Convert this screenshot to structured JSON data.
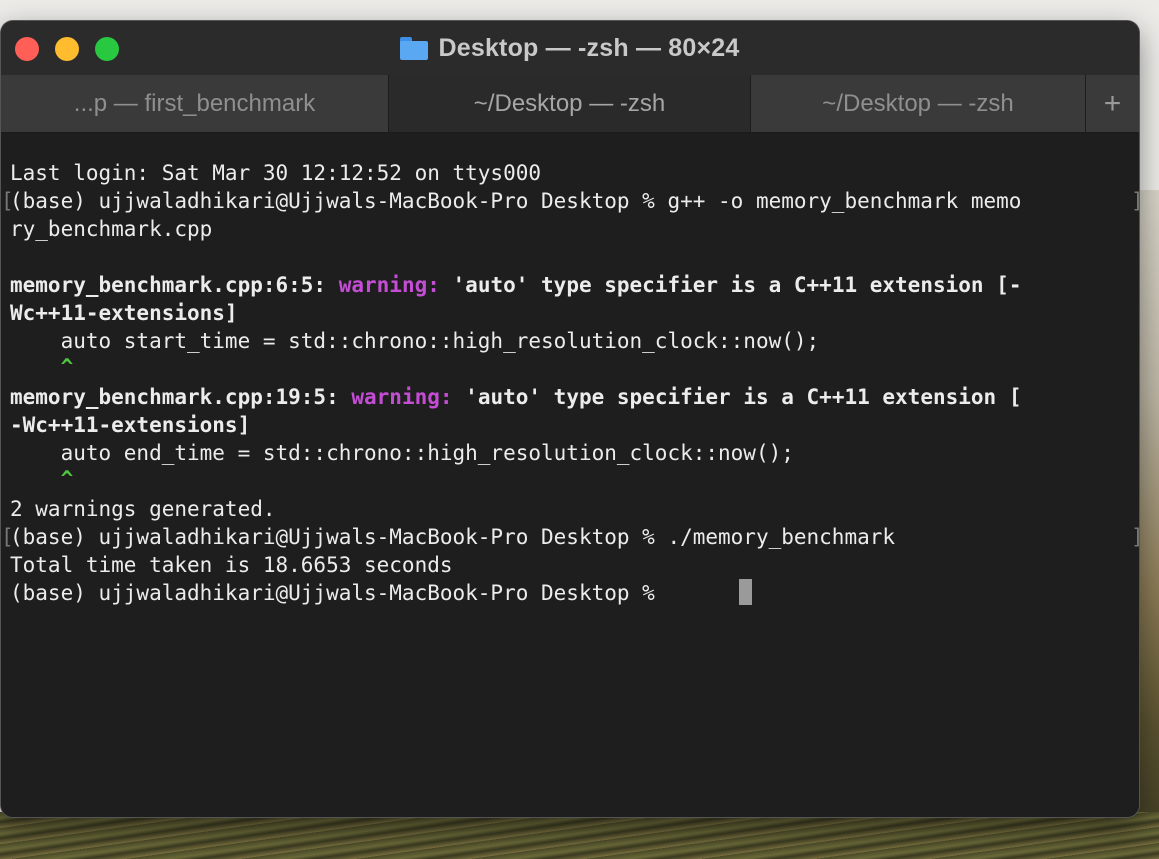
{
  "window": {
    "title": "Desktop — -zsh — 80×24",
    "folder_icon": "folder-icon",
    "close_color": "#ff5f57",
    "minimize_color": "#febc2e",
    "zoom_color": "#28c840"
  },
  "tabs": [
    {
      "label": "...p — first_benchmark",
      "active": false
    },
    {
      "label": "~/Desktop — -zsh",
      "active": true
    },
    {
      "label": "~/Desktop — -zsh",
      "active": false
    }
  ],
  "new_tab_label": "+",
  "terminal": {
    "last_login": "Last login: Sat Mar 30 12:12:52 on ttys000",
    "prompt1": "(base) ujjwaladhikari@Ujjwals-MacBook-Pro Desktop % g++ -o memory_benchmark memo",
    "prompt1_wrap": "ry_benchmark.cpp",
    "warn1_loc": "memory_benchmark.cpp:6:5: ",
    "warn_label": "warning:",
    "warn1_msg": " 'auto' type specifier is a C++11 extension [-",
    "warn1_flag": "Wc++11-extensions]",
    "warn1_code": "    auto start_time = std::chrono::high_resolution_clock::now();",
    "caret": "    ^",
    "warn2_loc": "memory_benchmark.cpp:19:5: ",
    "warn2_msg": " 'auto' type specifier is a C++11 extension [",
    "warn2_flag": "-Wc++11-extensions]",
    "warn2_code": "    auto end_time = std::chrono::high_resolution_clock::now();",
    "warnings_summary": "2 warnings generated.",
    "prompt2": "(base) ujjwaladhikari@Ujjwals-MacBook-Pro Desktop % ./memory_benchmark",
    "output": "Total time taken is 18.6653 seconds",
    "prompt3": "(base) ujjwaladhikari@Ujjwals-MacBook-Pro Desktop % "
  },
  "colors": {
    "warning": "#c54dd6",
    "caret": "#4fc43f",
    "background": "#1e1e1e",
    "text": "#ececec"
  }
}
